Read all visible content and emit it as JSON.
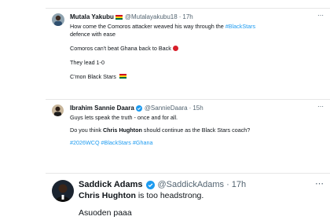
{
  "tweets": [
    {
      "name": "Mutala Yakubu",
      "flag": "ghana-flag-icon",
      "handle": "@Mutalayakubu18",
      "dot": "·",
      "time": "17h",
      "more": "⋯",
      "lines": [
        {
          "a": "How come the Comoros attacker weaved his way through the ",
          "tag": "#BlackStars"
        },
        {
          "a": "defence with ease"
        },
        {
          "a": "Comoros can't beat Ghana back to Back ",
          "emoji": "red-circle-icon"
        },
        {
          "a": "They lead 1-0"
        },
        {
          "a": "C'mon Black Stars ",
          "emoji": "ghana-flag-icon"
        }
      ]
    },
    {
      "name": "Ibrahim Sannie Daara",
      "handle": "@SannieDaara",
      "dot": "·",
      "time": "15h",
      "more": "⋯",
      "verified": true,
      "lines": [
        {
          "a": "Guys lets speak the truth - once and for all."
        },
        {
          "a": "Do you think ",
          "b": "Chris Hughton",
          "c": " should continue as the Black Stars coach?"
        },
        {
          "tags": "#2026WCQ #BlackStars #Ghana"
        }
      ]
    },
    {
      "name": "Saddick Adams",
      "handle": "@SaddickAdams",
      "dot": "·",
      "time": "17h",
      "more": "⋯",
      "verified": true,
      "lines": [
        {
          "b": "Chris Hughton",
          "c": " is too headstrong."
        },
        {
          "a": "Asuoden paaa"
        }
      ]
    }
  ],
  "colors": {
    "link": "#1d9bf0",
    "muted": "#536471",
    "verified": "#1d9bf0"
  }
}
